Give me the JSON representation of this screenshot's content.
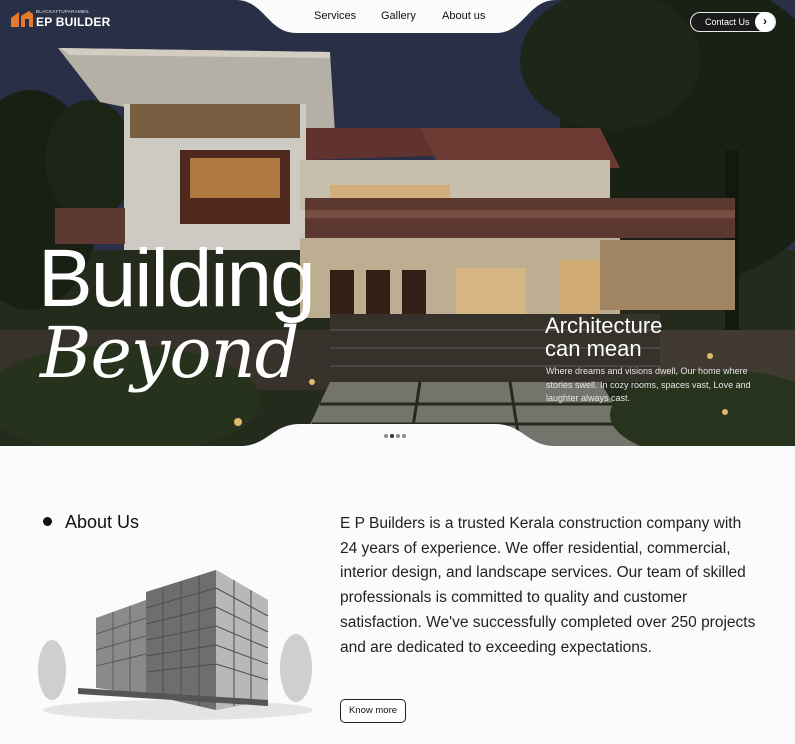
{
  "brand": {
    "tagline": "BLACKATTUPARAMBIL",
    "name": "EP BUILDER",
    "accent_color": "#e8782a"
  },
  "nav": {
    "items": [
      "Services",
      "Gallery",
      "About us"
    ]
  },
  "contact": {
    "label": "Contact Us",
    "icon": "chevron-right-icon"
  },
  "hero": {
    "headline_line1": "Building",
    "headline_line2": "Beyond",
    "side_title_line1": "Architecture",
    "side_title_line2": "can mean",
    "side_text": "Where dreams and visions dwell, Our home where stories swell. In cozy rooms, spaces vast, Love and laughter always cast.",
    "slides_total": 4,
    "active_slide": 2
  },
  "about": {
    "heading": "About Us",
    "body": "E P Builders is a trusted Kerala construction company with 24 years of experience. We offer residential, commercial, interior design, and landscape services. Our team of skilled professionals is committed to quality and customer satisfaction. We've successfully completed over 250 projects and are dedicated to exceeding expectations.",
    "button_label": "Know more"
  }
}
